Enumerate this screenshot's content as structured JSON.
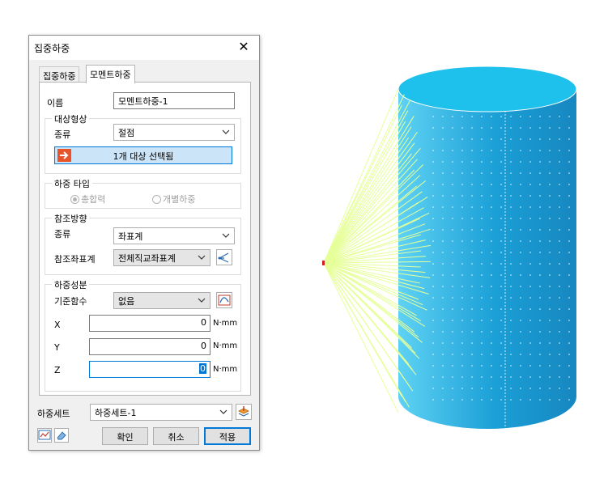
{
  "dialog": {
    "title": "집중하중",
    "close_glyph": "✕",
    "tabs": [
      {
        "label": "집중하중",
        "active": false
      },
      {
        "label": "모멘트하중",
        "active": true
      }
    ],
    "name_label": "이름",
    "name_value": "모멘트하중-1",
    "target": {
      "group_title": "대상형상",
      "type_label": "종류",
      "type_value": "절점",
      "select_button": "1개 대상 선택됨"
    },
    "load_type": {
      "group_title": "하중 타입",
      "option_resultant": "총합력",
      "option_individual": "개별하중",
      "selected": "총합력"
    },
    "reference": {
      "group_title": "참조방향",
      "type_label": "종류",
      "type_value": "좌표계",
      "coord_label": "참조좌표계",
      "coord_value": "전체직교좌표계"
    },
    "components": {
      "group_title": "하중성분",
      "basis_label": "기준함수",
      "basis_value": "없음",
      "x_label": "X",
      "x_value": "0",
      "y_label": "Y",
      "y_value": "0",
      "z_label": "Z",
      "z_value": "0",
      "unit": "N·mm"
    },
    "load_set": {
      "label": "하중세트",
      "value": "하중세트-1"
    },
    "buttons": {
      "ok": "확인",
      "cancel": "취소",
      "apply": "적용"
    }
  },
  "colors": {
    "accent": "#0078d7",
    "cylinder_top": "#1ec0ec",
    "cylinder_side": "#1a9fd6",
    "load_lines": "#e6ff99"
  }
}
